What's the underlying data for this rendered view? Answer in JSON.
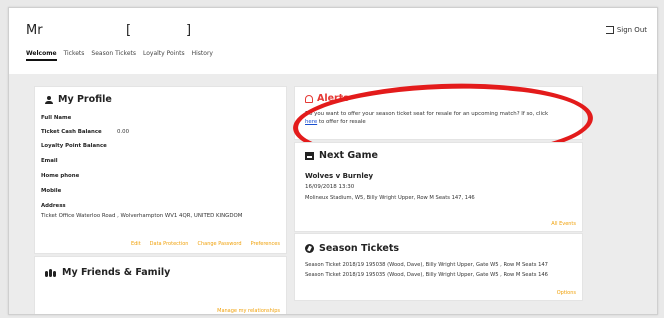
{
  "user": {
    "name": "Mr",
    "bracket_open": "[",
    "bracket_close": "]"
  },
  "header": {
    "sign_out": "Sign Out"
  },
  "tabs": [
    {
      "label": "Welcome",
      "active": true
    },
    {
      "label": "Tickets",
      "active": false
    },
    {
      "label": "Season Tickets",
      "active": false
    },
    {
      "label": "Loyalty Points",
      "active": false
    },
    {
      "label": "History",
      "active": false
    }
  ],
  "profile": {
    "title": "My Profile",
    "fields": [
      {
        "label": "Full Name",
        "value": ""
      },
      {
        "label": "Ticket Cash Balance",
        "value": "0.00"
      },
      {
        "label": "Loyalty Point Balance",
        "value": ""
      },
      {
        "label": "Email",
        "value": ""
      },
      {
        "label": "Home phone",
        "value": ""
      },
      {
        "label": "Mobile",
        "value": ""
      },
      {
        "label": "Address",
        "value": "Ticket Office Waterloo Road , Wolverhampton WV1 4QR, UNITED KINGDOM"
      }
    ],
    "actions": [
      "Edit",
      "Data Protection",
      "Change Password",
      "Preferences"
    ]
  },
  "friends": {
    "title": "My Friends & Family",
    "link": "Manage my relationships"
  },
  "alerts": {
    "title": "Alerts",
    "text_before": "Do you want to offer your season ticket seat for resale for an upcoming match? If so, click ",
    "link": "here",
    "text_after": " to offer for resale"
  },
  "next_game": {
    "title": "Next Game",
    "match": "Wolves v Burnley",
    "date": "16/09/2018 13:30",
    "venue": "Molineux Stadium, W5, Billy Wright Upper, Row M Seats 147, 146",
    "link": "All Events"
  },
  "season_tickets": {
    "title": "Season Tickets",
    "lines": [
      "Season Ticket 2018/19 195038 (Wood, Dave), Billy Wright Upper, Gate W5 , Row M Seats 147",
      "Season Ticket 2018/19 195035 (Wood, Dave), Billy Wright Upper, Gate W5 , Row M Seats 146"
    ],
    "link": "Options"
  },
  "colors": {
    "accent": "#f0a10a",
    "alert": "#e53935",
    "annotation": "#e31b1b"
  }
}
